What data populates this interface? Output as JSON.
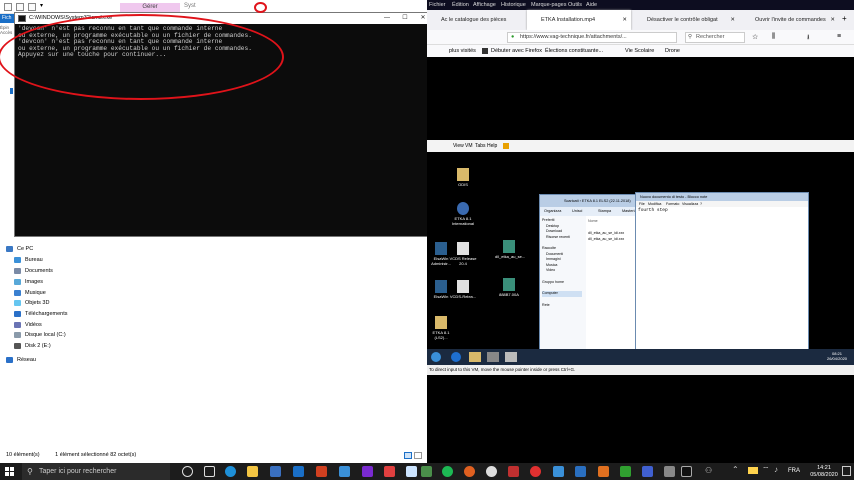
{
  "explorer": {
    "ribbon_tab": "Fich",
    "manage_label": "Gérer",
    "title_fragment": "Syst",
    "left_fragments": [
      "Épin",
      "Accès"
    ],
    "tree": [
      {
        "label": "Ce PC",
        "icon": "pc-icon",
        "color": "#3a78c4"
      },
      {
        "label": "Bureau",
        "icon": "desktop-folder-icon",
        "color": "#3a90d8"
      },
      {
        "label": "Documents",
        "icon": "documents-folder-icon",
        "color": "#7a8aa6"
      },
      {
        "label": "Images",
        "icon": "images-folder-icon",
        "color": "#58a8d8"
      },
      {
        "label": "Musique",
        "icon": "music-folder-icon",
        "color": "#3a80d0"
      },
      {
        "label": "Objets 3D",
        "icon": "objects3d-folder-icon",
        "color": "#66c6f0"
      },
      {
        "label": "Téléchargements",
        "icon": "downloads-folder-icon",
        "color": "#2a70c8"
      },
      {
        "label": "Vidéos",
        "icon": "videos-folder-icon",
        "color": "#6a74b4"
      },
      {
        "label": "Disque local (C:)",
        "icon": "drive-icon",
        "color": "#8a9aaa"
      },
      {
        "label": "Disk 2 (E:)",
        "icon": "drive-icon",
        "color": "#555"
      },
      {
        "label": "Réseau",
        "icon": "network-icon",
        "color": "#2a70c8"
      }
    ],
    "status": {
      "count": "10 élément(s)",
      "selection": "1 élément sélectionné  82 octet(s)"
    }
  },
  "cmd": {
    "title": "C:\\WINDOWS\\System32\\cmd.exe",
    "output": "'devcon' n'est pas reconnu en tant que commande interne\nou externe, un programme exécutable ou un fichier de commandes.\n'devcon' n'est pas reconnu en tant que commande interne\nou externe, un programme exécutable ou un fichier de commandes.\nAppuyez sur une touche pour continuer..."
  },
  "firefox": {
    "menu": [
      "Fichier",
      "Édition",
      "Affichage",
      "Historique",
      "Marque-pages",
      "Outils",
      "Aide"
    ],
    "tabs": [
      {
        "label": "Ac le catalogue des pièces",
        "active": false
      },
      {
        "label": "ETKA Installation.mp4",
        "active": true
      },
      {
        "label": "Désactiver le contrôle obligat",
        "active": false
      },
      {
        "label": "Ouvrir l'invite de commandes",
        "active": false
      }
    ],
    "url": "https://www.vag-technique.fr/attachments/...",
    "search_placeholder": "Rechercher",
    "bookmarks": [
      "plus visités",
      "Débuter avec Firefox",
      "Élections constituante...",
      "Vie Scolaire",
      "Drone"
    ]
  },
  "vm": {
    "menu": [
      "View",
      "VM",
      "Tabs",
      "Help"
    ],
    "desktop_icons": [
      {
        "label": "ODIS"
      },
      {
        "label": "ETKA 8.1 International"
      },
      {
        "label": "ElsaWin Administr..."
      },
      {
        "label": "VCDS Release 20.4"
      },
      {
        "label": "dll_etka_au_se..."
      },
      {
        "label": "ElsaWin"
      },
      {
        "label": "VCDS-Relea..."
      },
      {
        "label": "888B7.00A"
      },
      {
        "label": "ETKA 8.1 (LS2)..."
      }
    ],
    "explorer": {
      "breadcrumb": "Scaricati › ETKA 8.1 ELS2 (22.11.2018)",
      "toolbar": [
        "Organizza",
        "Unisci",
        "Stampa",
        "Masterizza"
      ],
      "column_header": "Nome",
      "favorites": [
        "Preferiti",
        "Desktop",
        "Download",
        "Risorse recenti"
      ],
      "libraries": [
        "Raccolte",
        "Documenti",
        "Immagini",
        "Musica",
        "Video"
      ],
      "other": [
        "Gruppo home",
        "Computer",
        "Rete"
      ],
      "files": [
        "dll_etka_au_se_idi.xxx",
        "dll_etka_au_se_idi.xxx"
      ],
      "details_name": "dll_etka_au_se_idi.xxx",
      "details_date": "Ultima modifica: 05/08..."
    },
    "notepad": {
      "title": "Nuovo documento di testo - Blocco note",
      "menu": [
        "File",
        "Modifica",
        "Formato",
        "Visualizza",
        "?"
      ],
      "text": "fourth step"
    },
    "clock": {
      "time": "08:21",
      "date": "26/04/2020"
    },
    "status_hint": "To direct input to this VM, move the mouse pointer inside or press Ctrl+G."
  },
  "taskbar": {
    "search_placeholder": "Taper ici pour rechercher",
    "language": "FRA",
    "time": "14:21",
    "date": "05/08/2020"
  }
}
